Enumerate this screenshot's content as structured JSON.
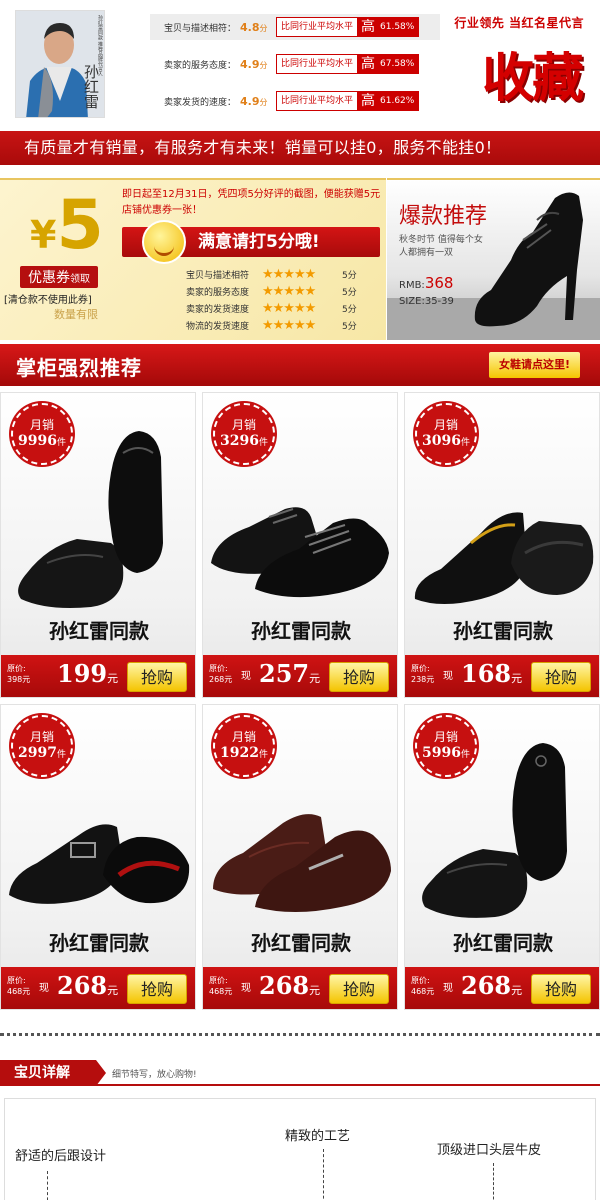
{
  "header": {
    "signature": "孙红雷",
    "portrait_caption": "孙红雷同款 推荐品牌代言人",
    "ratings": [
      {
        "label": "宝贝与描述相符：",
        "score": "4.8",
        "unit": "分",
        "compare": "比同行业平均水平",
        "level": "高",
        "percent": "61.58%"
      },
      {
        "label": "卖家的服务态度：",
        "score": "4.9",
        "unit": "分",
        "compare": "比同行业平均水平",
        "level": "高",
        "percent": "67.58%"
      },
      {
        "label": "卖家发货的速度：",
        "score": "4.9",
        "unit": "分",
        "compare": "比同行业平均水平",
        "level": "高",
        "percent": "61.62%"
      }
    ],
    "slogan": "行业领先  当红名星代言",
    "favorite": "收藏"
  },
  "banner": "有质量才有销量，有服务才有未来！销量可以挂0，服务不能挂0！",
  "coupon": {
    "yen": "¥",
    "amount": "5",
    "badge": "优惠券",
    "badge_small": "领取",
    "note": "[清仓款不使用此券]",
    "limit": "数量有限",
    "headline": "即日起至12月31日，凭四项5分好评的截图，便能获赠5元店铺优惠券一张！",
    "satisfy": "满意请打5分哦!",
    "rows": [
      {
        "label": "宝贝与描述相符",
        "stars": "★★★★★",
        "score": "5分"
      },
      {
        "label": "卖家的服务态度",
        "stars": "★★★★★",
        "score": "5分"
      },
      {
        "label": "卖家的发货速度",
        "stars": "★★★★★",
        "score": "5分"
      },
      {
        "label": "物流的发货速度",
        "stars": "★★★★★",
        "score": "5分"
      }
    ]
  },
  "hot": {
    "title": "爆款推荐",
    "subtitle": "秋冬时节 值得每个女人都拥有一双",
    "price_label": "RMB:",
    "price": "368",
    "size": "SIZE:35-39"
  },
  "section": {
    "title": "掌柜强烈推荐",
    "button": "女鞋请点这里!"
  },
  "products": [
    {
      "sales_label": "月销",
      "sales": "9996",
      "unit": "件",
      "name": "孙红雷同款",
      "orig_label": "原价:",
      "orig": "398元",
      "now": "",
      "price": "199",
      "yuan": "元",
      "buy": "抢购"
    },
    {
      "sales_label": "月销",
      "sales": "3296",
      "unit": "件",
      "name": "孙红雷同款",
      "orig_label": "原价:",
      "orig": "268元",
      "now": "现",
      "price": "257",
      "yuan": "元",
      "buy": "抢购"
    },
    {
      "sales_label": "月销",
      "sales": "3096",
      "unit": "件",
      "name": "孙红雷同款",
      "orig_label": "原价:",
      "orig": "238元",
      "now": "现",
      "price": "168",
      "yuan": "元",
      "buy": "抢购"
    },
    {
      "sales_label": "月销",
      "sales": "2997",
      "unit": "件",
      "name": "孙红雷同款",
      "orig_label": "原价:",
      "orig": "468元",
      "now": "现",
      "price": "268",
      "yuan": "元",
      "buy": "抢购"
    },
    {
      "sales_label": "月销",
      "sales": "1922",
      "unit": "件",
      "name": "孙红雷同款",
      "orig_label": "原价:",
      "orig": "468元",
      "now": "现",
      "price": "268",
      "yuan": "元",
      "buy": "抢购"
    },
    {
      "sales_label": "月销",
      "sales": "5996",
      "unit": "件",
      "name": "孙红雷同款",
      "orig_label": "原价:",
      "orig": "468元",
      "now": "现",
      "price": "268",
      "yuan": "元",
      "buy": "抢购"
    }
  ],
  "details": {
    "title": "宝贝详解",
    "subtitle": "细节特写，放心购物!",
    "features": [
      "舒适的后跟设计",
      "精致的工艺",
      "顶级进口头层牛皮"
    ]
  },
  "colors": {
    "brand_red": "#c61010",
    "gold": "#f4c400",
    "score_orange": "#e0801a"
  }
}
